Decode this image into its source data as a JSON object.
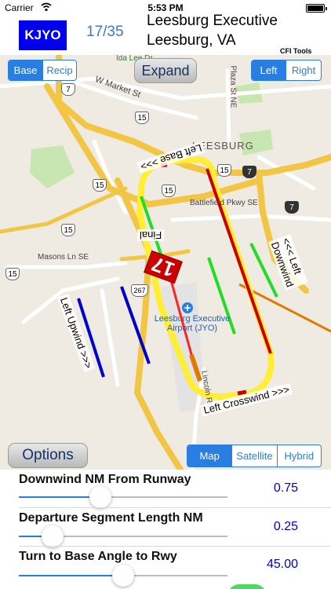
{
  "status_bar": {
    "carrier": "Carrier",
    "time": "5:53 PM"
  },
  "header": {
    "airport_code": "KJYO",
    "counter": "17/35",
    "airport_name": "Leesburg Executive",
    "airport_city": "Leesburg, VA",
    "app_label": "CFI Tools"
  },
  "map_controls": {
    "base_label": "Base",
    "recip_label": "Recip",
    "expand_label": "Expand",
    "left_label": "Left",
    "right_label": "Right",
    "options_label": "Options",
    "map_type": {
      "map": "Map",
      "satellite": "Satellite",
      "hybrid": "Hybrid"
    }
  },
  "map": {
    "runway_number": "17",
    "airport_label_1": "Leesburg Executive",
    "airport_label_2": "Airport (JYO)",
    "pattern_labels": {
      "left_base": "Left Base >>>",
      "final": "Final",
      "left_downwind": "<<< Left Downwind",
      "left_upwind": "Left Upwind >>>",
      "left_crosswind": "Left Crosswind >>>"
    },
    "streets": {
      "w_market": "W Market St",
      "plaza": "Plaza St NE",
      "battlefield": "Battlefield Pkwy SE",
      "masons": "Masons Ln SE",
      "ida": "Ida Lee Dr",
      "lincoln": "Lincoln Rd",
      "town": "LEESBURG"
    },
    "shields": {
      "rt7": "7",
      "rt15": "15",
      "rt267": "267"
    },
    "colors": {
      "green": "#22dd22",
      "blue": "#0000cc",
      "red": "#cc0000",
      "yellow": "#ffee33",
      "orange": "#e07a00"
    }
  },
  "settings": [
    {
      "label": "Downwind NM From Runway",
      "value": "0.75",
      "slider_fraction": 0.39
    },
    {
      "label": "Departure Segment Length NM",
      "value": "0.25",
      "slider_fraction": 0.16
    },
    {
      "label": "Turn to Base Angle to Rwy",
      "value": "45.00",
      "slider_fraction": 0.5
    }
  ]
}
